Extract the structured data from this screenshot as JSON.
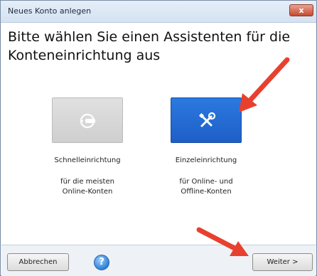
{
  "window": {
    "title": "Neues Konto anlegen",
    "close_glyph": "x"
  },
  "main": {
    "heading": "Bitte wählen Sie einen Assistenten für die Konteneinrichtung aus",
    "options": [
      {
        "title": "Schnelleinrichtung",
        "description_line1": "für die meisten",
        "description_line2": "Online-Konten",
        "icon": "plug-icon",
        "selected": false
      },
      {
        "title": "Einzeleinrichtung",
        "description_line1": "für Online- und",
        "description_line2": "Offline-Konten",
        "icon": "tools-icon",
        "selected": true
      }
    ]
  },
  "footer": {
    "cancel_label": "Abbrechen",
    "help_glyph": "?",
    "next_label": "Weiter >"
  },
  "colors": {
    "selected_card": "#1e5fc6",
    "unselected_card": "#d6d6d6",
    "annotation_arrow": "#e8402f"
  }
}
